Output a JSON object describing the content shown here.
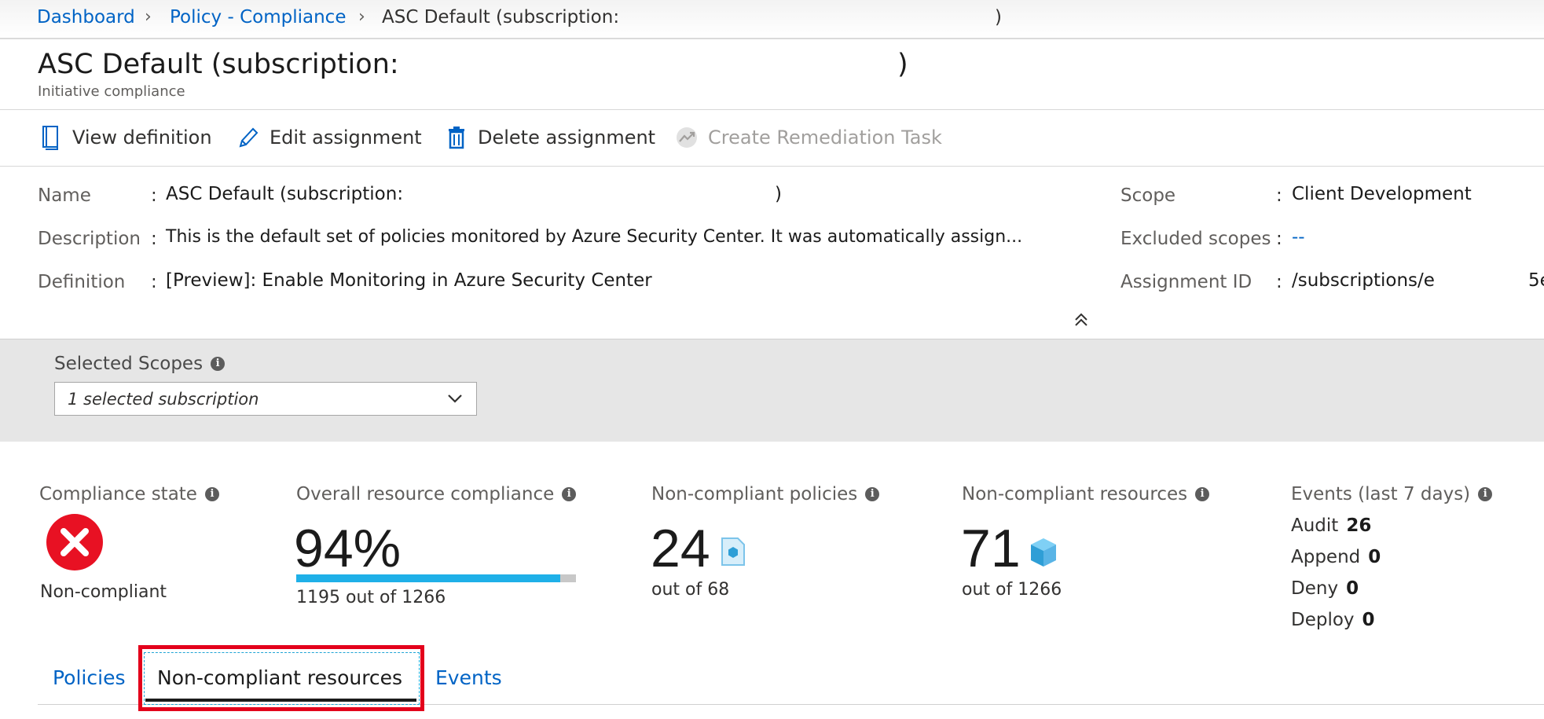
{
  "breadcrumb": {
    "items": [
      "Dashboard",
      "Policy - Compliance",
      "ASC Default (subscription:"
    ],
    "tail": ")"
  },
  "header": {
    "title": "ASC Default (subscription:",
    "title_tail": ")",
    "subtitle": "Initiative compliance"
  },
  "toolbar": {
    "view_definition": "View definition",
    "edit_assignment": "Edit assignment",
    "delete_assignment": "Delete assignment",
    "create_remediation": "Create Remediation Task"
  },
  "properties": {
    "name_label": "Name",
    "name_value": "ASC Default (subscription:",
    "name_tail": ")",
    "description_label": "Description",
    "description_value": "This is the default set of policies monitored by Azure Security Center. It was automatically assign...",
    "definition_label": "Definition",
    "definition_value": "[Preview]: Enable Monitoring in Azure Security Center",
    "scope_label": "Scope",
    "scope_value": "Client Development",
    "excluded_label": "Excluded scopes",
    "excluded_value": "--",
    "assignment_label": "Assignment ID",
    "assignment_value": "/subscriptions/e",
    "assignment_tail": "5e",
    "separator": ":"
  },
  "scopes": {
    "label": "Selected Scopes",
    "selected": "1 selected subscription"
  },
  "metrics": {
    "compliance_state_label": "Compliance state",
    "compliance_state_value": "Non-compliant",
    "overall_label": "Overall resource compliance",
    "overall_value": "94%",
    "overall_fraction": 0.944,
    "overall_sub": "1195 out of 1266",
    "policies_label": "Non-compliant policies",
    "policies_value": "24",
    "policies_sub": "out of 68",
    "resources_label": "Non-compliant resources",
    "resources_value": "71",
    "resources_sub": "out of 1266",
    "events_label": "Events (last 7 days)",
    "events": [
      {
        "name": "Audit",
        "count": "26"
      },
      {
        "name": "Append",
        "count": "0"
      },
      {
        "name": "Deny",
        "count": "0"
      },
      {
        "name": "Deploy",
        "count": "0"
      }
    ]
  },
  "tabs": {
    "policies": "Policies",
    "non_compliant_resources": "Non-compliant resources",
    "events": "Events"
  },
  "colors": {
    "link": "#0063c5",
    "error": "#e81123",
    "progress": "#1fb0e8",
    "highlight": "#e3001b"
  }
}
